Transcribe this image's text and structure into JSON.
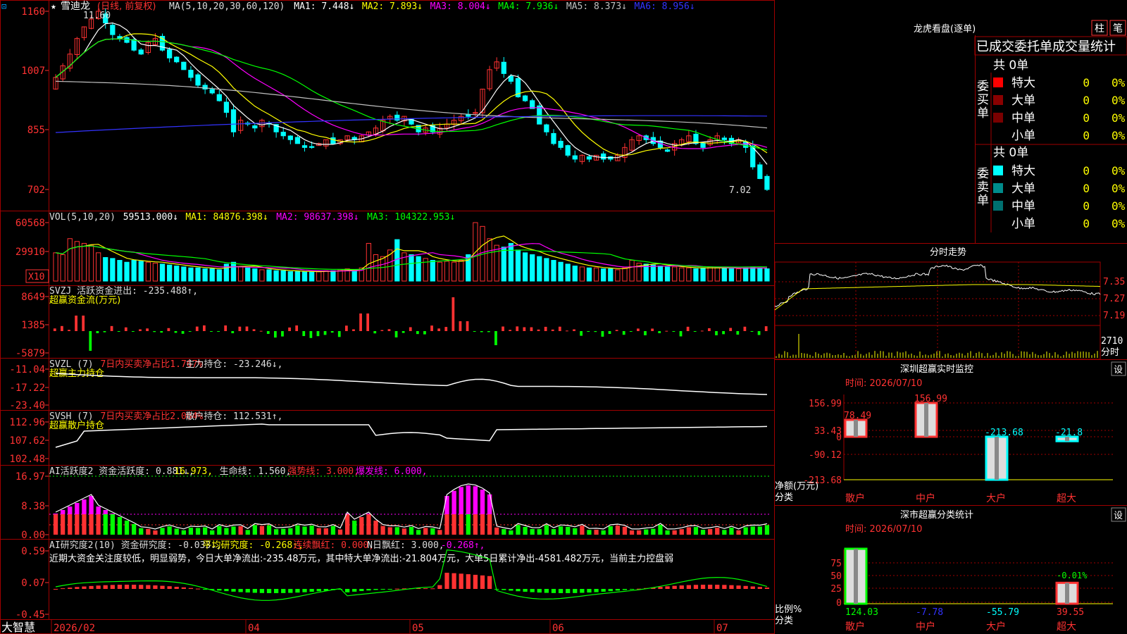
{
  "app": {
    "logo": "大智慧",
    "star": "★",
    "stock_name": "雪迪龙",
    "period": "(日线, 前复权)"
  },
  "colors": {
    "up": "#ff3232",
    "down": "#00ffff",
    "ma1": "#ffffff",
    "ma2": "#ffff00",
    "ma3": "#ff00ff",
    "ma4": "#00ff00",
    "ma5": "#c0c0c0",
    "ma6": "#3333ff",
    "grid": "#a00000",
    "axis_text": "#ff3232"
  },
  "main_header": [
    {
      "t": "MA(5,10,20,30,60,120)",
      "c": "#dddddd"
    },
    {
      "t": "MA1: 7.448↓",
      "c": "#ffffff"
    },
    {
      "t": "MA2: 7.893↓",
      "c": "#ffff00"
    },
    {
      "t": "MA3: 8.004↓",
      "c": "#ff00ff"
    },
    {
      "t": "MA4: 7.936↓",
      "c": "#00ff00"
    },
    {
      "t": "MA5: 8.373↓",
      "c": "#c0c0c0"
    },
    {
      "t": "MA6: 8.956↓",
      "c": "#3333ff"
    }
  ],
  "price_axis": [
    "1160",
    "1007",
    "855",
    "702"
  ],
  "price_notes": {
    "high": "11.60",
    "low": "7.02"
  },
  "vol_header": [
    {
      "t": "VOL(5,10,20)",
      "c": "#dddddd"
    },
    {
      "t": "59513.000↓",
      "c": "#ffffff"
    },
    {
      "t": "MA1: 84876.398↓",
      "c": "#ffff00"
    },
    {
      "t": "MA2: 98637.398↓",
      "c": "#ff00ff"
    },
    {
      "t": "MA3: 104322.953↓",
      "c": "#00ff00"
    }
  ],
  "vol_axis": [
    "60568",
    "29910"
  ],
  "vol_unit": "X10",
  "svzj_header": [
    {
      "t": "SVZJ  活跃资金进出: -235.488↑,",
      "c": "#dddddd"
    }
  ],
  "svzj_title": "超赢资金流(万元)",
  "svzj_axis": [
    "8649",
    "1385",
    "-5879"
  ],
  "svzl_header": [
    {
      "t": "SVZL (7)",
      "c": "#dddddd"
    },
    {
      "t": "7日内买卖净占比1.767%",
      "c": "#ff3232"
    },
    {
      "t": "主力持仓: -23.246↓,",
      "c": "#dddddd"
    }
  ],
  "svzl_title": "超赢主力持仓",
  "svzl_axis": [
    "-11.04",
    "-17.22",
    "-23.40"
  ],
  "svsh_header": [
    {
      "t": "SVSH (7)",
      "c": "#dddddd"
    },
    {
      "t": "7日内买卖净占比2.004%",
      "c": "#ff3232"
    },
    {
      "t": "散户持仓: 112.531↑,",
      "c": "#dddddd"
    }
  ],
  "svsh_title": "超赢散户持仓",
  "svsh_axis": [
    "112.96",
    "107.62",
    "102.48"
  ],
  "ai1_header": [
    {
      "t": "AI活跃度2 资金活跃度: 0.881↓,",
      "c": "#dddddd"
    },
    {
      "t": "16.973,",
      "c": "#ffff00"
    },
    {
      "t": "生命线: 1.560,",
      "c": "#dddddd"
    },
    {
      "t": "强势线: 3.000,",
      "c": "#ff3232"
    },
    {
      "t": "爆发线: 6.000,",
      "c": "#ff00ff"
    }
  ],
  "ai1_axis": [
    "16.97",
    "8.38",
    "0.00"
  ],
  "ai2_header": [
    {
      "t": "AI研究度2(10) 资金研究度: -0.033↓,",
      "c": "#dddddd"
    },
    {
      "t": "平均研究度: -0.268↑,",
      "c": "#ffff00"
    },
    {
      "t": "连续飘红: 0.000,",
      "c": "#ff3232"
    },
    {
      "t": "N日飘红: 3.000,",
      "c": "#dddddd"
    },
    {
      "t": "-0.268↑,",
      "c": "#ff00ff"
    }
  ],
  "ai2_text": "近期大资金关注度较低，明显弱势，今日大单净流出:-235.48万元，其中特大单净流出:-21.804万元，大单5日累计净出-4581.482万元，当前主力控盘弱",
  "ai2_axis": [
    "0.59",
    "0.07",
    "-0.45"
  ],
  "date_axis": [
    "2026/02",
    "04",
    "05",
    "06",
    "07"
  ],
  "right": {
    "lhb_title": "龙虎看盘(逐单)",
    "btn_zhu": "柱",
    "btn_bi": "笔",
    "tabs": [
      "已成交",
      "委托单",
      "成交量统计"
    ],
    "buy_label": "委买单",
    "sell_label": "委卖单",
    "total_buy": "共 0单",
    "total_sell": "共 0单",
    "buy_rows": [
      {
        "name": "特大",
        "count": "0",
        "pct": "0%",
        "color": "#ff0000"
      },
      {
        "name": "大单",
        "count": "0",
        "pct": "0%",
        "color": "#8b0000"
      },
      {
        "name": "中单",
        "count": "0",
        "pct": "0%",
        "color": "#7a0000"
      },
      {
        "name": "小单",
        "count": "0",
        "pct": "0%",
        "color": "#000000"
      }
    ],
    "sell_rows": [
      {
        "name": "特大",
        "count": "0",
        "pct": "0%",
        "color": "#00ffff"
      },
      {
        "name": "大单",
        "count": "0",
        "pct": "0%",
        "color": "#008b8b"
      },
      {
        "name": "中单",
        "count": "0",
        "pct": "0%",
        "color": "#007070"
      },
      {
        "name": "小单",
        "count": "0",
        "pct": "0%",
        "color": "#000000"
      }
    ],
    "intraday_title": "分时走势",
    "intraday_axis": [
      "7.35",
      "7.27",
      "7.19"
    ],
    "intraday_vol_label": "2710",
    "intraday_vol_unit": "分时",
    "sz_title": "深圳超赢实时监控",
    "sz_time": "时间: 2026/07/10",
    "sz_btn": "设",
    "sz_axis": [
      "156.99",
      "33.43",
      "0",
      "-90.12",
      "-213.68"
    ],
    "sz_ylabel": "净额(万元)",
    "sz_xlabel": "分类",
    "sz_categories": [
      "散户",
      "中户",
      "大户",
      "超大"
    ],
    "sz_values": [
      78.49,
      156.99,
      -213.68,
      -21.8
    ],
    "sz_value_labels": [
      "78.49",
      "156.99",
      "-213.68",
      "-21.8"
    ],
    "fl_title": "深市超赢分类统计",
    "fl_time": "时间: 2026/07/10",
    "fl_btn": "设",
    "fl_axis": [
      "75",
      "50",
      "25",
      "0"
    ],
    "fl_ylabel": "比例%",
    "fl_xlabel": "分类",
    "fl_categories": [
      "散户",
      "中户",
      "大户",
      "超大"
    ],
    "fl_values": [
      124.03,
      -7.78,
      -55.79,
      39.55
    ],
    "fl_value_labels": [
      "124.03",
      "-7.78",
      "-55.79",
      "39.55"
    ],
    "fl_note": "-0.01%"
  },
  "chart_data": [
    {
      "type": "candlestick",
      "title": "雪迪龙 (日线, 前复权)",
      "y_ticks": [
        "1160",
        "1007",
        "855",
        "702"
      ],
      "ylim": [
        6.8,
        11.8
      ],
      "x_ticks": [
        "2026/02",
        "04",
        "05",
        "06",
        "07"
      ],
      "close": [
        9.9,
        10.2,
        10.5,
        10.9,
        11.2,
        11.4,
        11.6,
        11.3,
        11.0,
        10.9,
        10.8,
        10.6,
        10.5,
        10.8,
        10.9,
        10.6,
        10.4,
        10.3,
        10.1,
        9.9,
        9.7,
        9.6,
        9.5,
        9.3,
        9.0,
        8.5,
        8.8,
        8.7,
        8.6,
        8.8,
        8.7,
        8.5,
        8.4,
        8.3,
        8.2,
        8.1,
        8.1,
        8.2,
        8.3,
        8.2,
        8.3,
        8.4,
        8.3,
        8.4,
        8.5,
        8.6,
        8.8,
        8.9,
        8.8,
        8.9,
        8.7,
        8.5,
        8.6,
        8.5,
        8.6,
        8.7,
        8.8,
        8.9,
        8.9,
        9.0,
        9.6,
        10.1,
        10.3,
        10.0,
        9.8,
        9.4,
        9.3,
        9.1,
        8.7,
        8.5,
        8.2,
        8.1,
        7.9,
        7.8,
        7.9,
        7.8,
        7.9,
        7.8,
        7.8,
        7.9,
        8.1,
        8.3,
        8.4,
        8.3,
        8.2,
        8.1,
        8.0,
        8.2,
        8.3,
        8.4,
        8.2,
        8.1,
        8.3,
        8.4,
        8.3,
        8.2,
        8.3,
        8.1,
        7.6,
        7.3,
        7.02
      ],
      "ma_values": {
        "MA1": 7.448,
        "MA2": 7.893,
        "MA3": 8.004,
        "MA4": 7.936,
        "MA5": 8.373,
        "MA6": 8.956
      },
      "annotations": [
        "11.60",
        "7.02"
      ]
    },
    {
      "type": "bar",
      "name": "VOL",
      "y_ticks": [
        "60568",
        "29910"
      ],
      "unit": "X10",
      "values": [
        30,
        28,
        45,
        42,
        40,
        38,
        30,
        25,
        24,
        22,
        20,
        22,
        21,
        20,
        19,
        18,
        17,
        16,
        15,
        14,
        14,
        13,
        13,
        12,
        18,
        20,
        15,
        14,
        13,
        12,
        12,
        11,
        11,
        10,
        10,
        10,
        10,
        10,
        11,
        11,
        12,
        13,
        12,
        14,
        40,
        28,
        26,
        33,
        44,
        30,
        28,
        26,
        24,
        22,
        20,
        21,
        20,
        22,
        28,
        62,
        58,
        45,
        38,
        36,
        40,
        33,
        30,
        28,
        26,
        24,
        22,
        20,
        18,
        16,
        15,
        14,
        14,
        13,
        13,
        12,
        14,
        22,
        19,
        18,
        17,
        16,
        15,
        15,
        14,
        14,
        13,
        14,
        15,
        14,
        14,
        13,
        13,
        14,
        15,
        14,
        13
      ]
    },
    {
      "type": "bar",
      "name": "SVZJ 超赢资金流(万元)",
      "y_ticks": [
        "8649",
        "1385",
        "-5879"
      ]
    },
    {
      "type": "line",
      "name": "SVZL 超赢主力持仓",
      "y_ticks": [
        "-11.04",
        "-17.22",
        "-23.40"
      ]
    },
    {
      "type": "line",
      "name": "SVSH 超赢散户持仓",
      "y_ticks": [
        "112.96",
        "107.62",
        "102.48"
      ]
    },
    {
      "type": "bar",
      "name": "AI活跃度2",
      "y_ticks": [
        "16.97",
        "8.38",
        "0.00"
      ]
    },
    {
      "type": "bar",
      "name": "AI研究度2(10)",
      "y_ticks": [
        "0.59",
        "0.07",
        "-0.45"
      ]
    },
    {
      "type": "bar",
      "name": "深圳超赢实时监控",
      "categories": [
        "散户",
        "中户",
        "大户",
        "超大"
      ],
      "values": [
        78.49,
        156.99,
        -213.68,
        -21.8
      ],
      "ylabel": "净额(万元)",
      "xlabel": "分类",
      "y_ticks": [
        "156.99",
        "33.43",
        "0",
        "-90.12",
        "-213.68"
      ]
    },
    {
      "type": "bar",
      "name": "深市超赢分类统计",
      "categories": [
        "散户",
        "中户",
        "大户",
        "超大"
      ],
      "values": [
        124.03,
        -7.78,
        -55.79,
        39.55
      ],
      "ylabel": "比例%",
      "xlabel": "分类",
      "y_ticks": [
        "75",
        "50",
        "25",
        "0"
      ]
    }
  ]
}
